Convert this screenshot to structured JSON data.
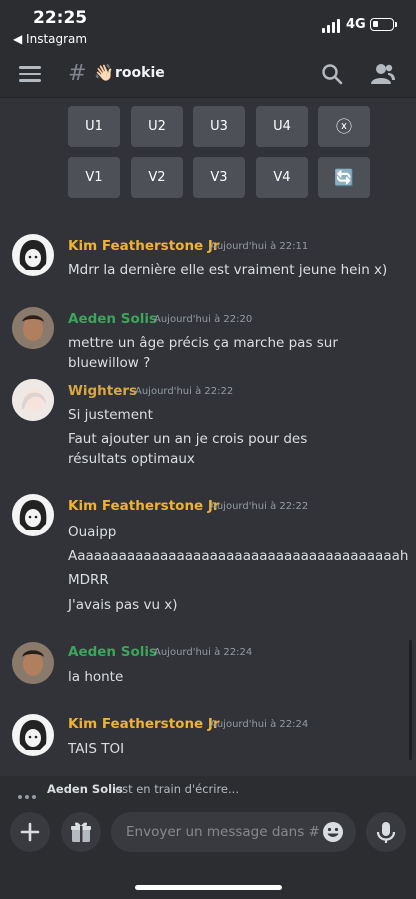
{
  "status_bar": {
    "time": "22:25",
    "back_app": "◀ Instagram",
    "network": "4G"
  },
  "header": {
    "hash": "#",
    "channel_emoji": "👋🏻",
    "channel_name": "rookie"
  },
  "buttons": {
    "row1": [
      "U1",
      "U2",
      "U3",
      "U4"
    ],
    "row2": [
      "V1",
      "V2",
      "V3",
      "V4"
    ],
    "cancel_symbol": "ⓧ",
    "reroll_symbol": "🔄"
  },
  "messages": [
    {
      "author": "Kim Featherstone Jr",
      "timestamp": "Aujourd'hui à 22:11",
      "lines": [
        "Mdrr la dernière elle est vraiment jeune hein x)"
      ]
    },
    {
      "author": "Aeden Solis",
      "timestamp": "Aujourd'hui à 22:20",
      "lines": [
        "mettre un âge précis ça marche pas sur bluewillow ?"
      ]
    },
    {
      "author": "Wighters",
      "timestamp": "Aujourd'hui à 22:22",
      "lines": [
        "Si justement",
        "Faut ajouter un an je crois pour des résultats optimaux"
      ]
    },
    {
      "author": "Kim Featherstone Jr",
      "timestamp": "Aujourd'hui à 22:22",
      "lines": [
        "Ouaipp",
        "Aaaaaaaaaaaaaaaaaaaaaaaaaaaaaaaaaaaaaaaah",
        "MDRR",
        "J'avais pas vu x)"
      ]
    },
    {
      "author": "Aeden Solis",
      "timestamp": "Aujourd'hui à 22:24",
      "lines": [
        "la honte"
      ]
    },
    {
      "author": "Kim Featherstone Jr",
      "timestamp": "Aujourd'hui à 22:24",
      "lines": [
        "TAIS TOI"
      ]
    }
  ],
  "typing": {
    "user": "Aeden Solis",
    "text": "est en train d'écrire..."
  },
  "composer": {
    "placeholder": "Envoyer un message dans #…"
  },
  "colors": {
    "background": "#313338",
    "kim": "#f0b232",
    "aeden": "#3ba55c",
    "wighters": "#d9a93e"
  }
}
